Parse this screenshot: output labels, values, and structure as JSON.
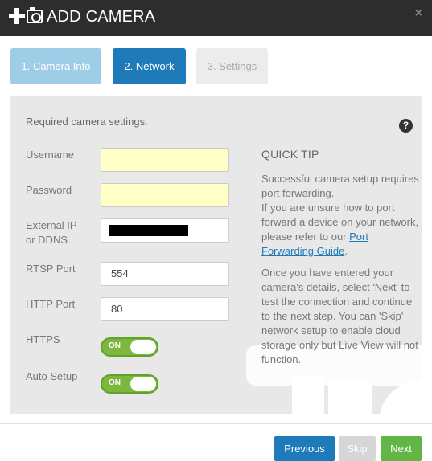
{
  "header": {
    "title": "ADD CAMERA",
    "close_icon": "×",
    "icons": [
      "plus-icon",
      "camera-icon"
    ]
  },
  "steps": [
    {
      "label": "1. Camera Info",
      "state": "done"
    },
    {
      "label": "2. Network",
      "state": "active"
    },
    {
      "label": "3. Settings",
      "state": "disabled"
    }
  ],
  "form": {
    "required_text": "Required camera settings.",
    "help_icon": "?",
    "username": {
      "label": "Username",
      "value": ""
    },
    "password": {
      "label": "Password",
      "value": ""
    },
    "external_ip": {
      "label_line1": "External IP",
      "label_line2": "or DDNS",
      "value": "[redacted]"
    },
    "rtsp_port": {
      "label": "RTSP Port",
      "value": "554"
    },
    "http_port": {
      "label": "HTTP Port",
      "value": "80"
    },
    "https": {
      "label": "HTTPS",
      "state": "ON"
    },
    "auto_setup": {
      "label": "Auto Setup",
      "state": "ON"
    }
  },
  "tip": {
    "title": "QUICK TIP",
    "p1_line1": "Successful camera setup requires port forwarding.",
    "p1_line2": "If you are unsure how to port forward a device on your network, please refer to our ",
    "link": "Port Forwarding Guide",
    "p1_end": ".",
    "p2": "Once you have entered your camera's details, select 'Next' to test the connection and continue to the next step. You can 'Skip' network setup to enable cloud storage only but Live View will not function."
  },
  "footer": {
    "previous": "Previous",
    "skip": "Skip",
    "next": "Next"
  },
  "colors": {
    "header_bg": "#2d2d2d",
    "primary": "#1e7ab8",
    "step_done": "#9ecde8",
    "toggle_on": "#7cb83e",
    "next": "#62b547",
    "empty_field": "#ffffc6"
  }
}
